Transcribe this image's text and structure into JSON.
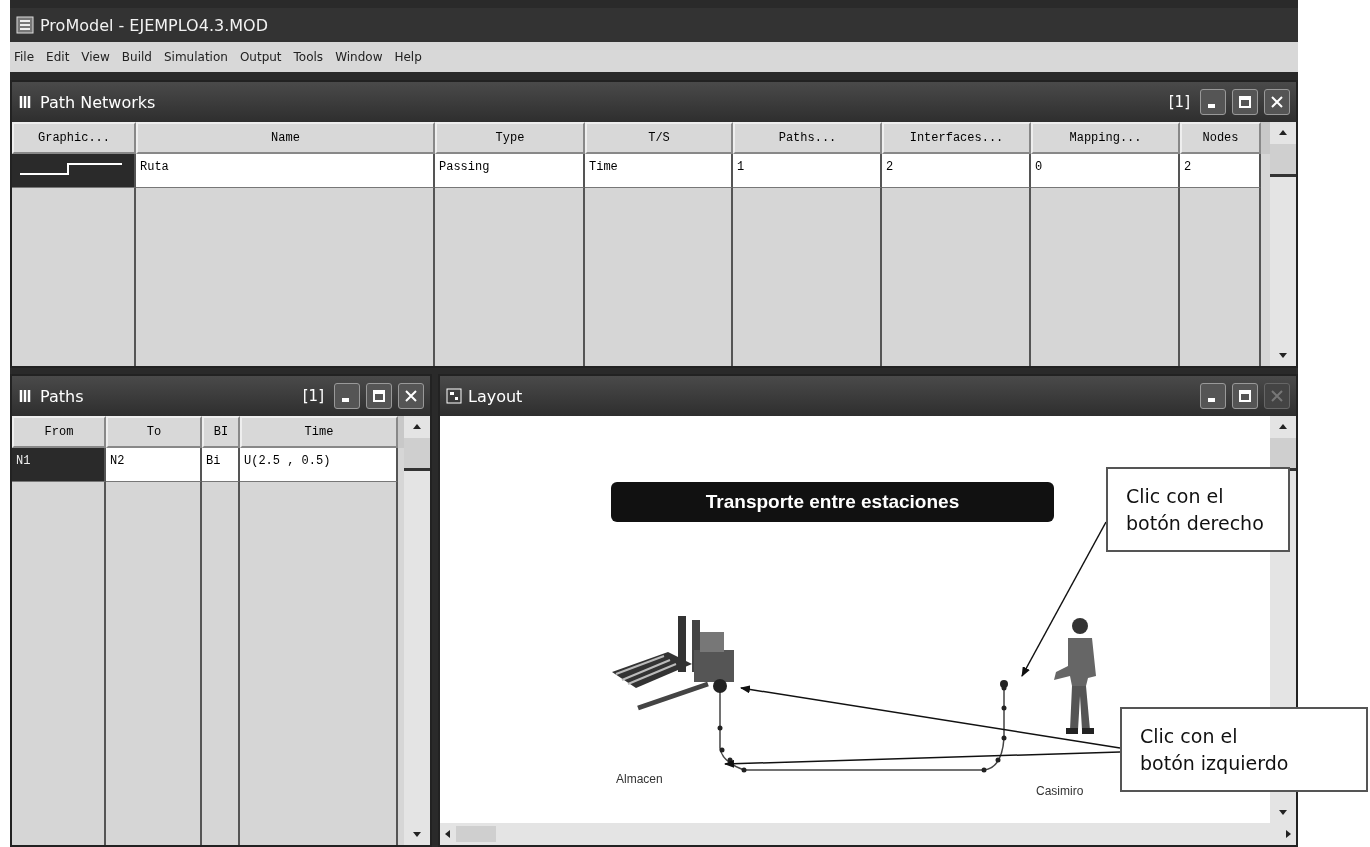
{
  "window": {
    "title": "ProModel - EJEMPLO4.3.MOD"
  },
  "menu": [
    "File",
    "Edit",
    "View",
    "Build",
    "Simulation",
    "Output",
    "Tools",
    "Window",
    "Help"
  ],
  "path_networks": {
    "title": "Path Networks",
    "count": "[1]",
    "controls": [
      {
        "kind": "minimize",
        "disabled": false
      },
      {
        "kind": "maximize",
        "disabled": false
      },
      {
        "kind": "close",
        "disabled": false
      }
    ],
    "columns": [
      "Graphic...",
      "Name",
      "Type",
      "T/S",
      "Paths...",
      "Interfaces...",
      "Mapping...",
      "Nodes"
    ],
    "rows": [
      {
        "graphic": {
          "selected": true
        },
        "cells": [
          "Ruta",
          "Passing",
          "Time",
          "1",
          "2",
          "0",
          "2"
        ]
      }
    ]
  },
  "paths": {
    "title": "Paths",
    "count": "[1]",
    "controls": [
      {
        "kind": "minimize",
        "disabled": false
      },
      {
        "kind": "maximize",
        "disabled": false
      },
      {
        "kind": "close",
        "disabled": false
      }
    ],
    "columns": [
      "From",
      "To",
      "BI",
      "Time"
    ],
    "rows": [
      {
        "cells": [
          {
            "text": "N1",
            "selected": true
          },
          {
            "text": "N2",
            "selected": false
          },
          {
            "text": "Bi",
            "selected": false
          },
          {
            "text": "U(2.5 , 0.5)",
            "selected": false
          }
        ]
      }
    ]
  },
  "layout": {
    "title": "Layout",
    "controls": [
      {
        "kind": "minimize",
        "disabled": false
      },
      {
        "kind": "maximize",
        "disabled": false
      },
      {
        "kind": "close",
        "disabled": true
      }
    ],
    "banner": "Transporte entre estaciones",
    "locations": [
      {
        "kind": "forklift",
        "label": "Almacen"
      },
      {
        "kind": "person",
        "label": "Casimiro"
      }
    ]
  },
  "callouts": [
    {
      "text": "Clic con el\nbotón derecho"
    },
    {
      "text": "Clic con el\nbotón izquierdo"
    }
  ]
}
